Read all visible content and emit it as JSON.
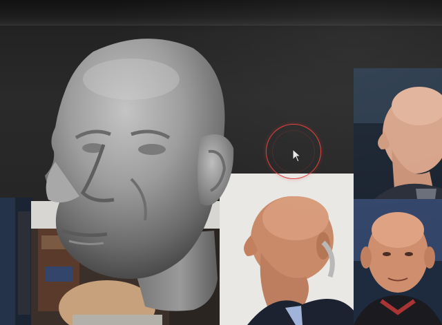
{
  "app": {
    "name": "",
    "viewport": {
      "model": {
        "type": "sculpted-head",
        "material_color": "#9e9e9e"
      },
      "cursor": {
        "icon": "arrow-pointer-icon",
        "ring_color": "#e0403b"
      }
    },
    "reference_images": [
      {
        "id": "ref-profile-right",
        "icon": "bald-man-profile"
      },
      {
        "id": "ref-profile-left",
        "icon": "bald-man-profile"
      },
      {
        "id": "ref-front-portrait",
        "icon": "bald-man-front"
      },
      {
        "id": "ref-scene-left",
        "icon": "scene-photo"
      },
      {
        "id": "ref-strip-left",
        "icon": "dark-strip"
      }
    ]
  }
}
